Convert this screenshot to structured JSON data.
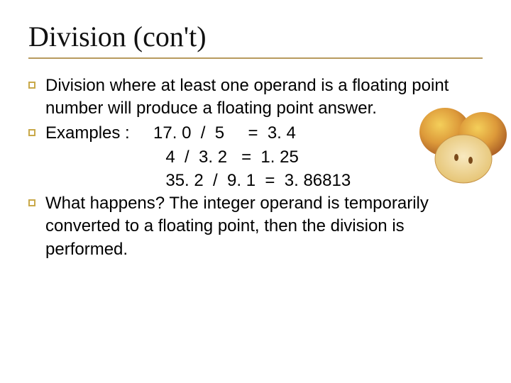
{
  "title": "Division (con't)",
  "bullets": {
    "b1": "Division where at least one operand is a floating point number will produce a floating point answer.",
    "b2_label": "Examples :",
    "b2_line1": "     17. 0  /  5     =  3. 4",
    "b2_line2": "     4  /  3. 2   =  1. 25",
    "b2_line3": "     35. 2  /  9. 1  =  3. 86813",
    "b3": "What happens?  The integer operand is temporarily converted to a floating point, then the division is performed."
  },
  "image_alt": "Sliced apples decorative image"
}
